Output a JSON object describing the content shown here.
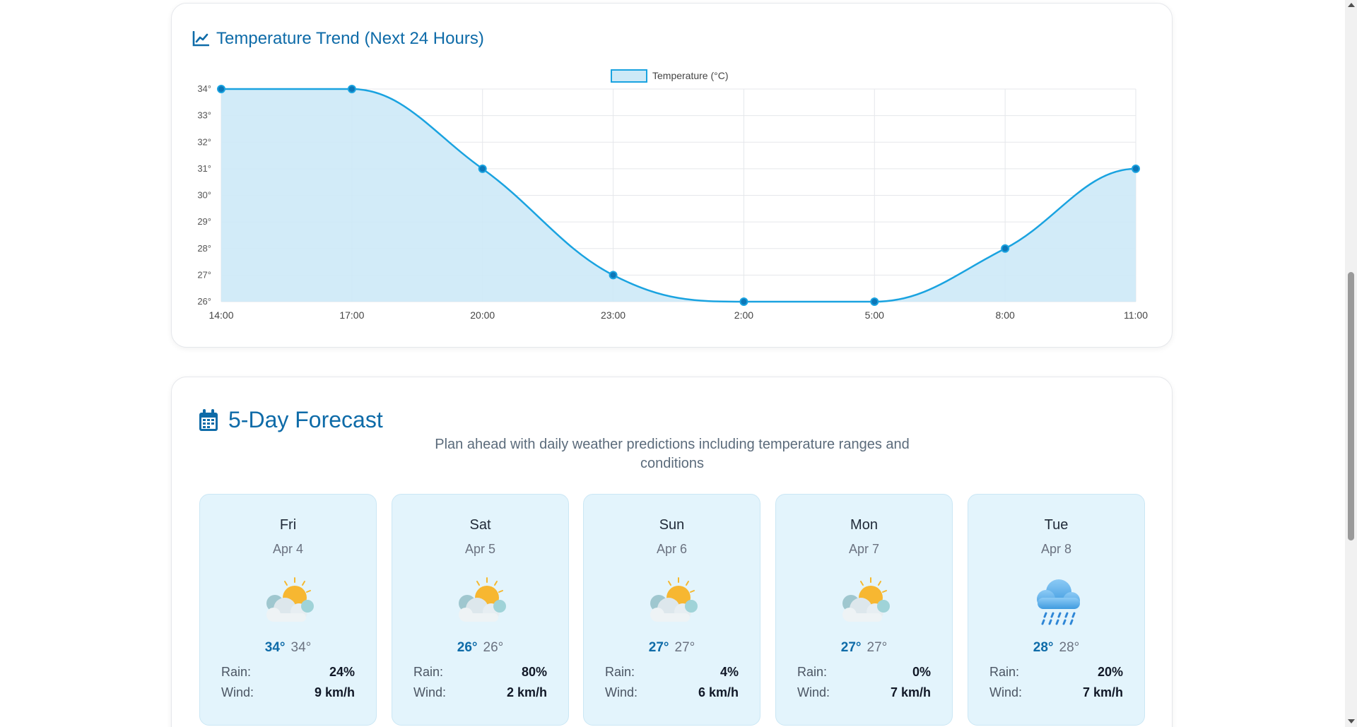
{
  "trend": {
    "title": "Temperature Trend (Next 24 Hours)",
    "icon": "chart-line-icon"
  },
  "chart_data": {
    "type": "area",
    "series": [
      {
        "name": "Temperature (°C)",
        "values": [
          34,
          34,
          31,
          27,
          26,
          26,
          28,
          31
        ]
      }
    ],
    "categories": [
      "14:00",
      "17:00",
      "20:00",
      "23:00",
      "2:00",
      "5:00",
      "8:00",
      "11:00"
    ],
    "y_ticks": [
      "26°",
      "27°",
      "28°",
      "29°",
      "30°",
      "31°",
      "32°",
      "33°",
      "34°"
    ],
    "ylim": [
      26,
      34
    ],
    "grid": true,
    "legend": "top-center",
    "colors": {
      "line": "#1aa3e0",
      "fill": "#cde9f7",
      "point": "#0c77b8"
    }
  },
  "forecast": {
    "title": "5-Day Forecast",
    "icon": "calendar-icon",
    "subtitle": "Plan ahead with daily weather predictions including temperature ranges and conditions",
    "rain_label": "Rain:",
    "wind_label": "Wind:",
    "days": [
      {
        "day": "Fri",
        "date": "Apr 4",
        "icon": "partly-cloudy-icon",
        "high": "34°",
        "low": "34°",
        "rain": "24%",
        "wind": "9 km/h"
      },
      {
        "day": "Sat",
        "date": "Apr 5",
        "icon": "partly-cloudy-icon",
        "high": "26°",
        "low": "26°",
        "rain": "80%",
        "wind": "2 km/h"
      },
      {
        "day": "Sun",
        "date": "Apr 6",
        "icon": "partly-cloudy-icon",
        "high": "27°",
        "low": "27°",
        "rain": "4%",
        "wind": "6 km/h"
      },
      {
        "day": "Mon",
        "date": "Apr 7",
        "icon": "partly-cloudy-icon",
        "high": "27°",
        "low": "27°",
        "rain": "0%",
        "wind": "7 km/h"
      },
      {
        "day": "Tue",
        "date": "Apr 8",
        "icon": "rain-cloud-icon",
        "high": "28°",
        "low": "28°",
        "rain": "20%",
        "wind": "7 km/h"
      }
    ]
  }
}
